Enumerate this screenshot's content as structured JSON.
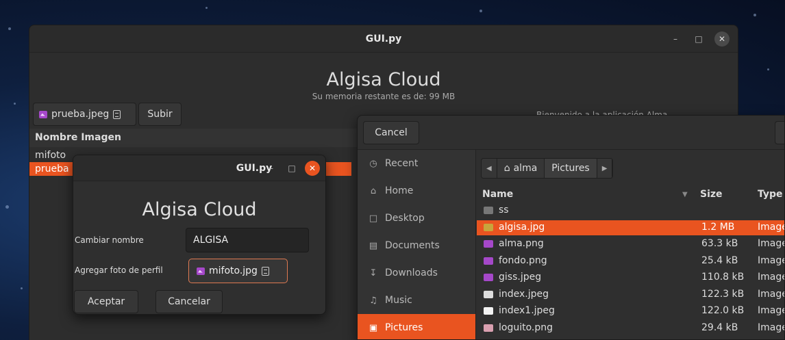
{
  "main_window": {
    "title": "GUI.py",
    "app_title": "Algisa Cloud",
    "subtitle": "Su memoria restante es de: 99 MB",
    "welcome": "Bienvenido a la aplicación Alma",
    "file_button": "prueba.jpeg",
    "upload_button": "Subir",
    "table_header": "Nombre Imagen",
    "rows": [
      "mifoto",
      "prueba"
    ],
    "selected_row": "prueba"
  },
  "dialog": {
    "title": "GUI.py",
    "app_title": "Algisa Cloud",
    "rename_label": "Cambiar nombre",
    "rename_value": "ALGISA",
    "photo_label": "Agregar foto de perfil",
    "photo_button": "mifoto.jpg",
    "accept_button": "Aceptar",
    "cancel_button": "Cancelar"
  },
  "file_chooser": {
    "cancel_button": "Cancel",
    "sidebar": [
      {
        "label": "Recent",
        "icon": "clock-icon"
      },
      {
        "label": "Home",
        "icon": "home-icon"
      },
      {
        "label": "Desktop",
        "icon": "desktop-icon"
      },
      {
        "label": "Documents",
        "icon": "documents-icon"
      },
      {
        "label": "Downloads",
        "icon": "download-icon"
      },
      {
        "label": "Music",
        "icon": "music-icon"
      },
      {
        "label": "Pictures",
        "icon": "pictures-icon"
      }
    ],
    "selected_place": "Pictures",
    "path": [
      "alma",
      "Pictures"
    ],
    "columns": {
      "name": "Name",
      "size": "Size",
      "type": "Type"
    },
    "files": [
      {
        "name": "ss",
        "size": "",
        "type": "",
        "icon": "folder-icon"
      },
      {
        "name": "algisa.jpg",
        "size": "1.2 MB",
        "type": "Image",
        "icon": "image-icon"
      },
      {
        "name": "alma.png",
        "size": "63.3 kB",
        "type": "Image",
        "icon": "image-icon"
      },
      {
        "name": "fondo.png",
        "size": "25.4 kB",
        "type": "Image",
        "icon": "image-icon"
      },
      {
        "name": "giss.jpeg",
        "size": "110.8 kB",
        "type": "Image",
        "icon": "image-icon"
      },
      {
        "name": "index.jpeg",
        "size": "122.3 kB",
        "type": "Image",
        "icon": "image-icon"
      },
      {
        "name": "index1.jpeg",
        "size": "122.0 kB",
        "type": "Image",
        "icon": "image-icon"
      },
      {
        "name": "loguito.png",
        "size": "29.4 kB",
        "type": "Image",
        "icon": "image-icon"
      }
    ],
    "selected_file": "algisa.jpg"
  },
  "colors": {
    "accent": "#e95420",
    "window_bg": "#2d2d2d"
  }
}
